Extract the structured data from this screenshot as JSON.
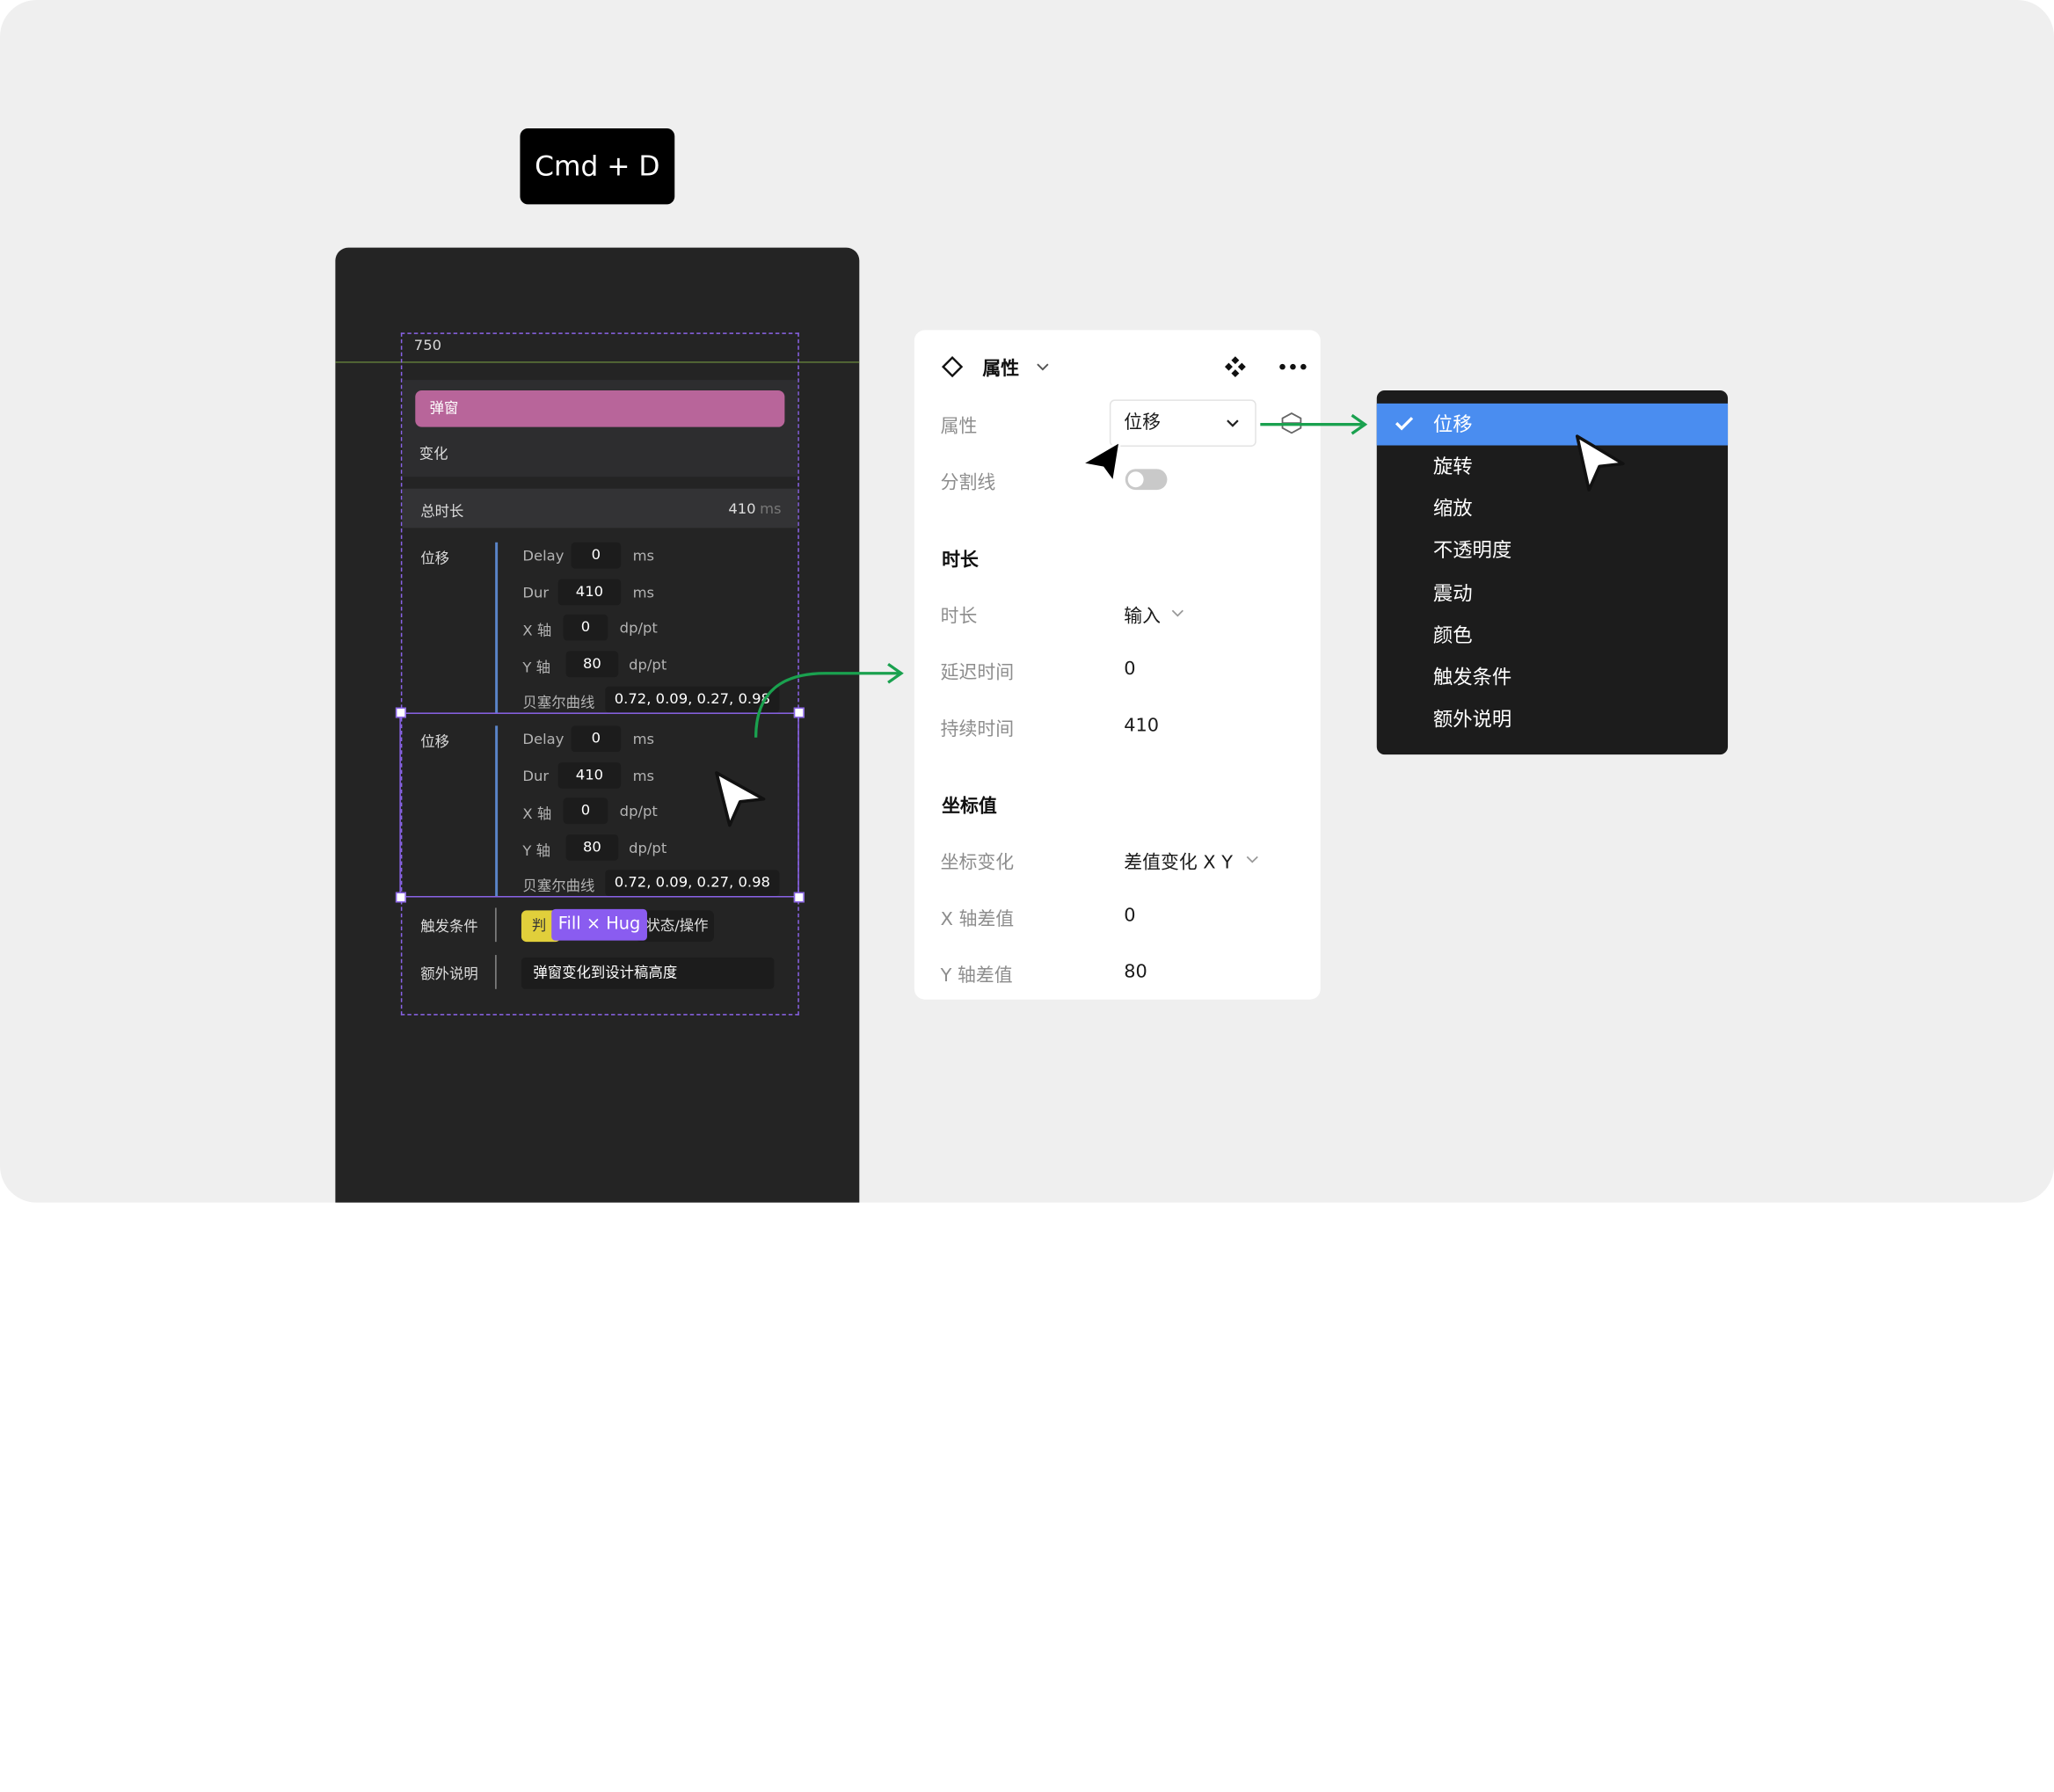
{
  "shortcut": "Cmd + D",
  "canvas": {
    "frame_width_label": "750",
    "popup_label": "弹窗",
    "change_label": "变化",
    "total_label": "总时长",
    "total_value": "410",
    "total_unit": "ms",
    "blocks": [
      {
        "name": "位移",
        "rows": [
          {
            "label": "Delay",
            "value": "0",
            "unit": "ms"
          },
          {
            "label": "Dur",
            "value": "410",
            "unit": "ms"
          },
          {
            "label": "X 轴",
            "value": "0",
            "unit": "dp/pt"
          },
          {
            "label": "Y 轴",
            "value": "80",
            "unit": "dp/pt"
          },
          {
            "label": "贝塞尔曲线",
            "value": "0.72, 0.09, 0.27, 0.98",
            "unit": ""
          }
        ]
      },
      {
        "name": "位移",
        "rows": [
          {
            "label": "Delay",
            "value": "0",
            "unit": "ms"
          },
          {
            "label": "Dur",
            "value": "410",
            "unit": "ms"
          },
          {
            "label": "X 轴",
            "value": "0",
            "unit": "dp/pt"
          },
          {
            "label": "Y 轴",
            "value": "80",
            "unit": "dp/pt"
          },
          {
            "label": "贝塞尔曲线",
            "value": "0.72, 0.09, 0.27, 0.98",
            "unit": ""
          }
        ]
      }
    ],
    "trigger_label": "触发条件",
    "trigger_tag_left": "判",
    "trigger_tag_right": "状态/操作",
    "hug_badge": "Fill × Hug",
    "note_label": "额外说明",
    "note_value": "弹窗变化到设计稿高度"
  },
  "panel": {
    "title": "属性",
    "prop_label": "属性",
    "prop_value": "位移",
    "divider_label": "分割线",
    "duration_section": "时长",
    "duration_label": "时长",
    "duration_mode": "输入",
    "delay_label": "延迟时间",
    "delay_value": "0",
    "sustain_label": "持续时间",
    "sustain_value": "410",
    "coord_section": "坐标值",
    "coord_change_label": "坐标变化",
    "coord_change_value": "差值变化 X Y",
    "x_diff_label": "X 轴差值",
    "x_diff_value": "0",
    "y_diff_label": "Y 轴差值",
    "y_diff_value": "80"
  },
  "menu": {
    "items": [
      "位移",
      "旋转",
      "缩放",
      "不透明度",
      "震动",
      "颜色",
      "触发条件",
      "额外说明"
    ],
    "selected": "位移"
  },
  "colors": {
    "accent_purple": "#8a63e8",
    "pink": "#b8659a",
    "green_arrow": "#1aa14f",
    "menu_selected": "#4a8df0"
  }
}
